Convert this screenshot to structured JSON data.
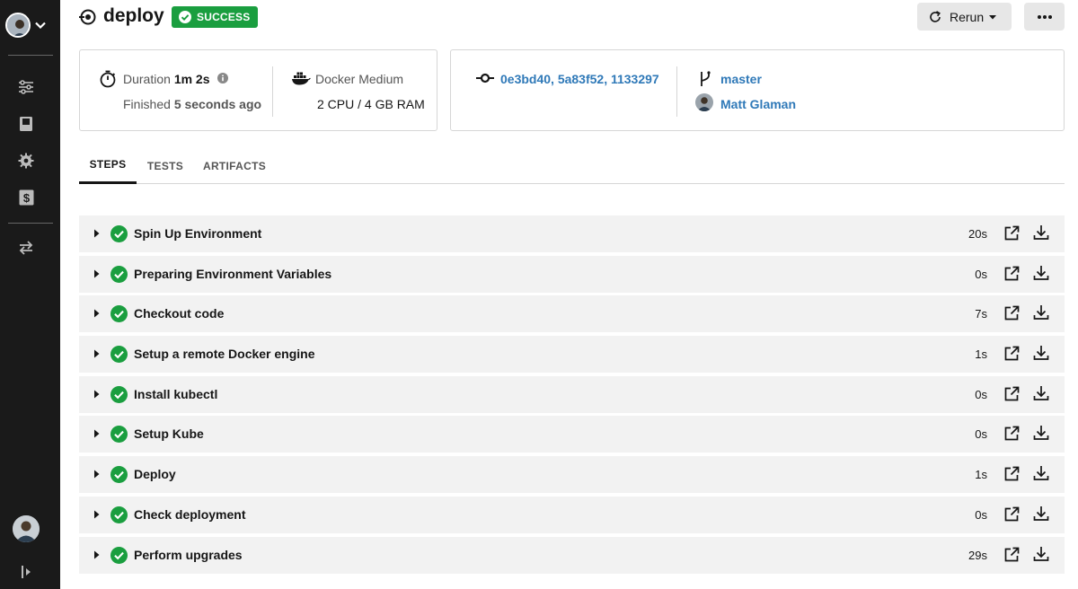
{
  "header": {
    "title": "deploy",
    "status_badge": "SUCCESS",
    "rerun_label": "Rerun",
    "more_icon": "more-horizontal-icon"
  },
  "colors": {
    "success": "#1a9e3f",
    "link": "#2f79b8",
    "sidebar_bg": "#1a1a1a",
    "step_bg": "#f2f2f2"
  },
  "summary": {
    "duration_label": "Duration",
    "duration_value": "1m 2s",
    "finished_label": "Finished",
    "finished_value": "5 seconds ago",
    "resource_class": "Docker Medium",
    "resources": "2 CPU / 4 GB RAM",
    "commits": "0e3bd40, 5a83f52, 1133297",
    "branch": "master",
    "author": "Matt Glaman"
  },
  "tabs": [
    {
      "label": "STEPS",
      "active": true
    },
    {
      "label": "TESTS",
      "active": false
    },
    {
      "label": "ARTIFACTS",
      "active": false
    }
  ],
  "steps": [
    {
      "name": "Spin Up Environment",
      "duration": "20s"
    },
    {
      "name": "Preparing Environment Variables",
      "duration": "0s"
    },
    {
      "name": "Checkout code",
      "duration": "7s"
    },
    {
      "name": "Setup a remote Docker engine",
      "duration": "1s"
    },
    {
      "name": "Install kubectl",
      "duration": "0s"
    },
    {
      "name": "Setup Kube",
      "duration": "0s"
    },
    {
      "name": "Deploy",
      "duration": "1s"
    },
    {
      "name": "Check deployment",
      "duration": "0s"
    },
    {
      "name": "Perform upgrades",
      "duration": "29s"
    }
  ],
  "sidebar": {
    "icons": [
      "pipelines-icon",
      "insights-icon",
      "settings-icon",
      "billing-icon",
      "transfer-icon"
    ]
  }
}
